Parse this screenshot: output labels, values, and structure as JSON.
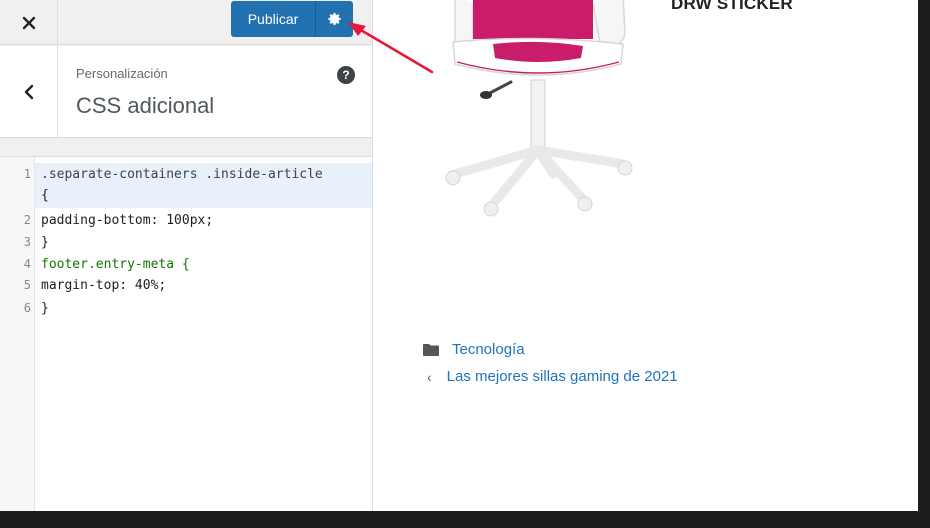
{
  "topbar": {
    "publish_label": "Publicar"
  },
  "section": {
    "breadcrumb": "Personalización",
    "title": "CSS adicional",
    "help": "?"
  },
  "editor": {
    "lines": [
      {
        "n": "1",
        "text": ".separate-containers .inside-article"
      },
      {
        "n": "",
        "text": "{"
      },
      {
        "n": "2",
        "text": "padding-bottom: 100px;"
      },
      {
        "n": "3",
        "text": "}"
      },
      {
        "n": "4",
        "text": "footer.entry-meta {"
      },
      {
        "n": "5",
        "text": "margin-top: 40%;"
      },
      {
        "n": "6",
        "text": "}"
      }
    ]
  },
  "preview": {
    "product_title": "DRW STICKER",
    "category": "Tecnología",
    "prev_post": "Las mejores sillas gaming de 2021"
  },
  "colors": {
    "accent": "#2271b1",
    "link": "#1e73be",
    "annotation_arrow": "#e8173a"
  }
}
